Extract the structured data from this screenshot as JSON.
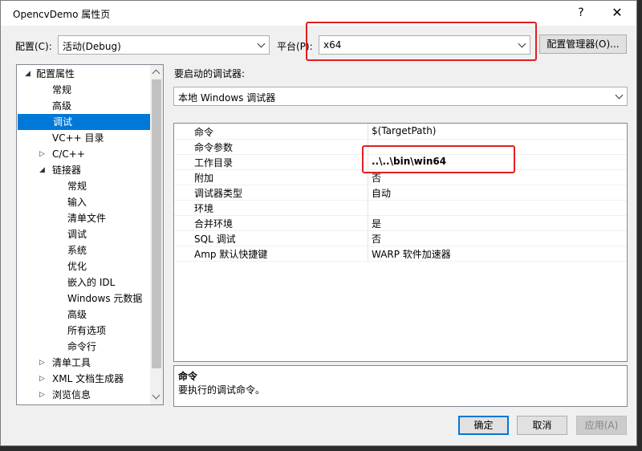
{
  "window": {
    "title": "OpencvDemo 属性页",
    "help_label": "?",
    "close_label": "✕"
  },
  "config_row": {
    "config_label": "配置(C):",
    "config_value": "活动(Debug)",
    "platform_label": "平台(P):",
    "platform_value": "x64",
    "manager_button": "配置管理器(O)..."
  },
  "tree": {
    "items": [
      {
        "label": "配置属性",
        "expander": "◢"
      },
      {
        "label": "常规",
        "expander": ""
      },
      {
        "label": "高级",
        "expander": ""
      },
      {
        "label": "调试",
        "expander": "",
        "selected": true
      },
      {
        "label": "VC++ 目录",
        "expander": ""
      },
      {
        "label": "C/C++",
        "expander": "▷"
      },
      {
        "label": "链接器",
        "expander": "◢"
      },
      {
        "label": "常规",
        "expander": ""
      },
      {
        "label": "输入",
        "expander": ""
      },
      {
        "label": "清单文件",
        "expander": ""
      },
      {
        "label": "调试",
        "expander": ""
      },
      {
        "label": "系统",
        "expander": ""
      },
      {
        "label": "优化",
        "expander": ""
      },
      {
        "label": "嵌入的 IDL",
        "expander": ""
      },
      {
        "label": "Windows 元数据",
        "expander": ""
      },
      {
        "label": "高级",
        "expander": ""
      },
      {
        "label": "所有选项",
        "expander": ""
      },
      {
        "label": "命令行",
        "expander": ""
      },
      {
        "label": "清单工具",
        "expander": "▷"
      },
      {
        "label": "XML 文档生成器",
        "expander": "▷"
      },
      {
        "label": "浏览信息",
        "expander": "▷"
      }
    ]
  },
  "debugger": {
    "label": "要启动的调试器:",
    "value": "本地 Windows 调试器"
  },
  "properties": [
    {
      "name": "命令",
      "value": "$(TargetPath)"
    },
    {
      "name": "命令参数",
      "value": ""
    },
    {
      "name": "工作目录",
      "value": "..\\..\\bin\\win64"
    },
    {
      "name": "附加",
      "value": "否"
    },
    {
      "name": "调试器类型",
      "value": "自动"
    },
    {
      "name": "环境",
      "value": ""
    },
    {
      "name": "合并环境",
      "value": "是"
    },
    {
      "name": "SQL 调试",
      "value": "否"
    },
    {
      "name": "Amp 默认快捷键",
      "value": "WARP 软件加速器"
    }
  ],
  "description": {
    "title": "命令",
    "text": "要执行的调试命令。"
  },
  "buttons": {
    "ok": "确定",
    "cancel": "取消",
    "apply": "应用(A)"
  },
  "colors": {
    "selection": "#0078d7",
    "highlight_box": "#e02020"
  }
}
